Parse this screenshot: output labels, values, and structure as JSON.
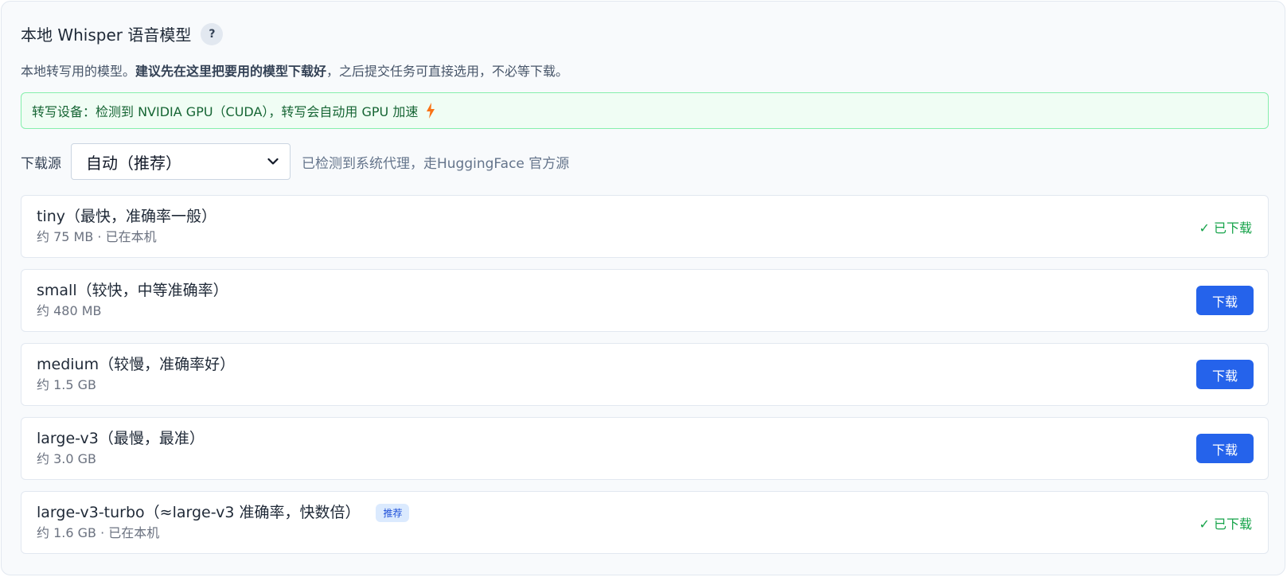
{
  "header": {
    "title": "本地 Whisper 语音模型",
    "help_label": "?"
  },
  "description": {
    "prefix": "本地转写用的模型。",
    "bold": "建议先在这里把要用的模型下载好",
    "suffix": "，之后提交任务可直接选用，不必等下载。"
  },
  "device_banner": {
    "text": "转写设备：检测到 NVIDIA GPU（CUDA），转写会自动用 GPU 加速",
    "icon": "lightning-bolt-icon",
    "color": "#166534"
  },
  "download_source": {
    "label": "下载源",
    "selected": "自动（推荐）",
    "hint": "已检测到系统代理，走HuggingFace 官方源"
  },
  "colors": {
    "accent": "#2563eb",
    "success": "#16a34a",
    "badge_bg": "#dbeafe"
  },
  "models": [
    {
      "name": "tiny（最快，准确率一般）",
      "meta": "约 75 MB · 已在本机",
      "status": "downloaded",
      "status_label": "✓ 已下载",
      "badge": ""
    },
    {
      "name": "small（较快，中等准确率）",
      "meta": "约 480 MB",
      "status": "available",
      "status_label": "下载",
      "badge": ""
    },
    {
      "name": "medium（较慢，准确率好）",
      "meta": "约 1.5 GB",
      "status": "available",
      "status_label": "下载",
      "badge": ""
    },
    {
      "name": "large-v3（最慢，最准）",
      "meta": "约 3.0 GB",
      "status": "available",
      "status_label": "下载",
      "badge": ""
    },
    {
      "name": "large-v3-turbo（≈large-v3 准确率，快数倍）",
      "meta": "约 1.6 GB · 已在本机",
      "status": "downloaded",
      "status_label": "✓ 已下载",
      "badge": "推荐"
    }
  ]
}
